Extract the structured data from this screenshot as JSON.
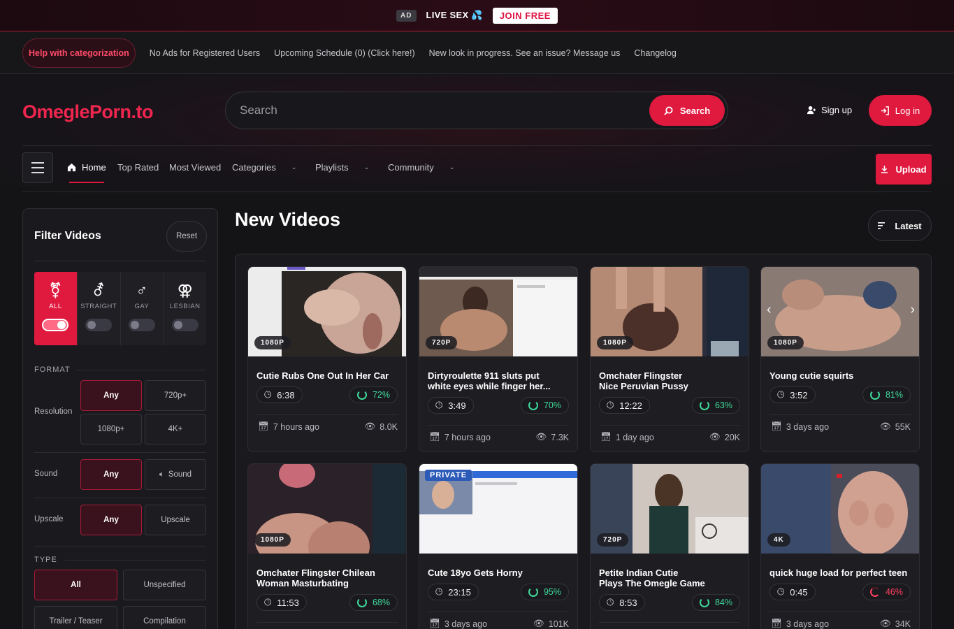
{
  "ad": {
    "tag": "AD",
    "text": "LIVE SEX 💦",
    "cta": "JOIN FREE"
  },
  "notices": {
    "pill": "Help with categorization",
    "links": [
      "No Ads for Registered Users",
      "Upcoming Schedule (0) (Click here!)",
      "New look in progress. See an issue? Message us",
      "Changelog"
    ]
  },
  "header": {
    "logo": "OmeglePorn.to",
    "search_placeholder": "Search",
    "search_button": "Search",
    "signup": "Sign up",
    "login": "Log in"
  },
  "nav": {
    "items": [
      "Home",
      "Top Rated",
      "Most Viewed",
      "Categories",
      "Playlists",
      "Community"
    ],
    "upload": "Upload"
  },
  "filter": {
    "title": "Filter Videos",
    "reset": "Reset",
    "orientations": [
      "ALL",
      "STRAIGHT",
      "GAY",
      "LESBIAN"
    ],
    "format_label": "FORMAT",
    "resolution_label": "Resolution",
    "resolution_options": [
      "Any",
      "720p+",
      "1080p+",
      "4K+"
    ],
    "sound_label": "Sound",
    "sound_options": [
      "Any",
      "Sound"
    ],
    "upscale_label": "Upscale",
    "upscale_options": [
      "Any",
      "Upscale"
    ],
    "type_label": "TYPE",
    "type_options": [
      "All",
      "Unspecified",
      "Trailer / Teaser",
      "Compilation"
    ]
  },
  "main": {
    "title": "New Videos",
    "sort": "Latest"
  },
  "videos": [
    {
      "res": "1080P",
      "title": "Cutie Rubs One Out In Her Car",
      "dur": "6:38",
      "rating": "72%",
      "age": "7 hours ago",
      "views": "8.0K"
    },
    {
      "res": "720P",
      "title": "Dirtyroulette 911 sluts put\nwhite eyes while finger her...",
      "dur": "3:49",
      "rating": "70%",
      "age": "7 hours ago",
      "views": "7.3K"
    },
    {
      "res": "1080P",
      "title": "Omchater Flingster\nNice Peruvian Pussy",
      "dur": "12:22",
      "rating": "63%",
      "age": "1 day ago",
      "views": "20K"
    },
    {
      "res": "1080P",
      "title": "Young cutie squirts",
      "dur": "3:52",
      "rating": "81%",
      "age": "3 days ago",
      "views": "55K"
    },
    {
      "res": "1080P",
      "title": "Omchater Flingster Chilean\nWoman Masturbating",
      "dur": "11:53",
      "rating": "68%",
      "age": "",
      "views": ""
    },
    {
      "res": "",
      "private": "PRIVATE",
      "title": "Cute 18yo Gets Horny",
      "dur": "23:15",
      "rating": "95%",
      "age": "3 days ago",
      "views": "101K"
    },
    {
      "res": "720P",
      "title": "Petite Indian Cutie\nPlays The Omegle Game",
      "dur": "8:53",
      "rating": "84%",
      "age": "",
      "views": ""
    },
    {
      "res": "4K",
      "title": "quick huge load for perfect teen",
      "dur": "0:45",
      "rating": "46%",
      "age": "3 days ago",
      "views": "34K"
    }
  ],
  "colors": {
    "accent": "#e0193f",
    "good": "#3fd89a",
    "bad": "#ff4060"
  }
}
